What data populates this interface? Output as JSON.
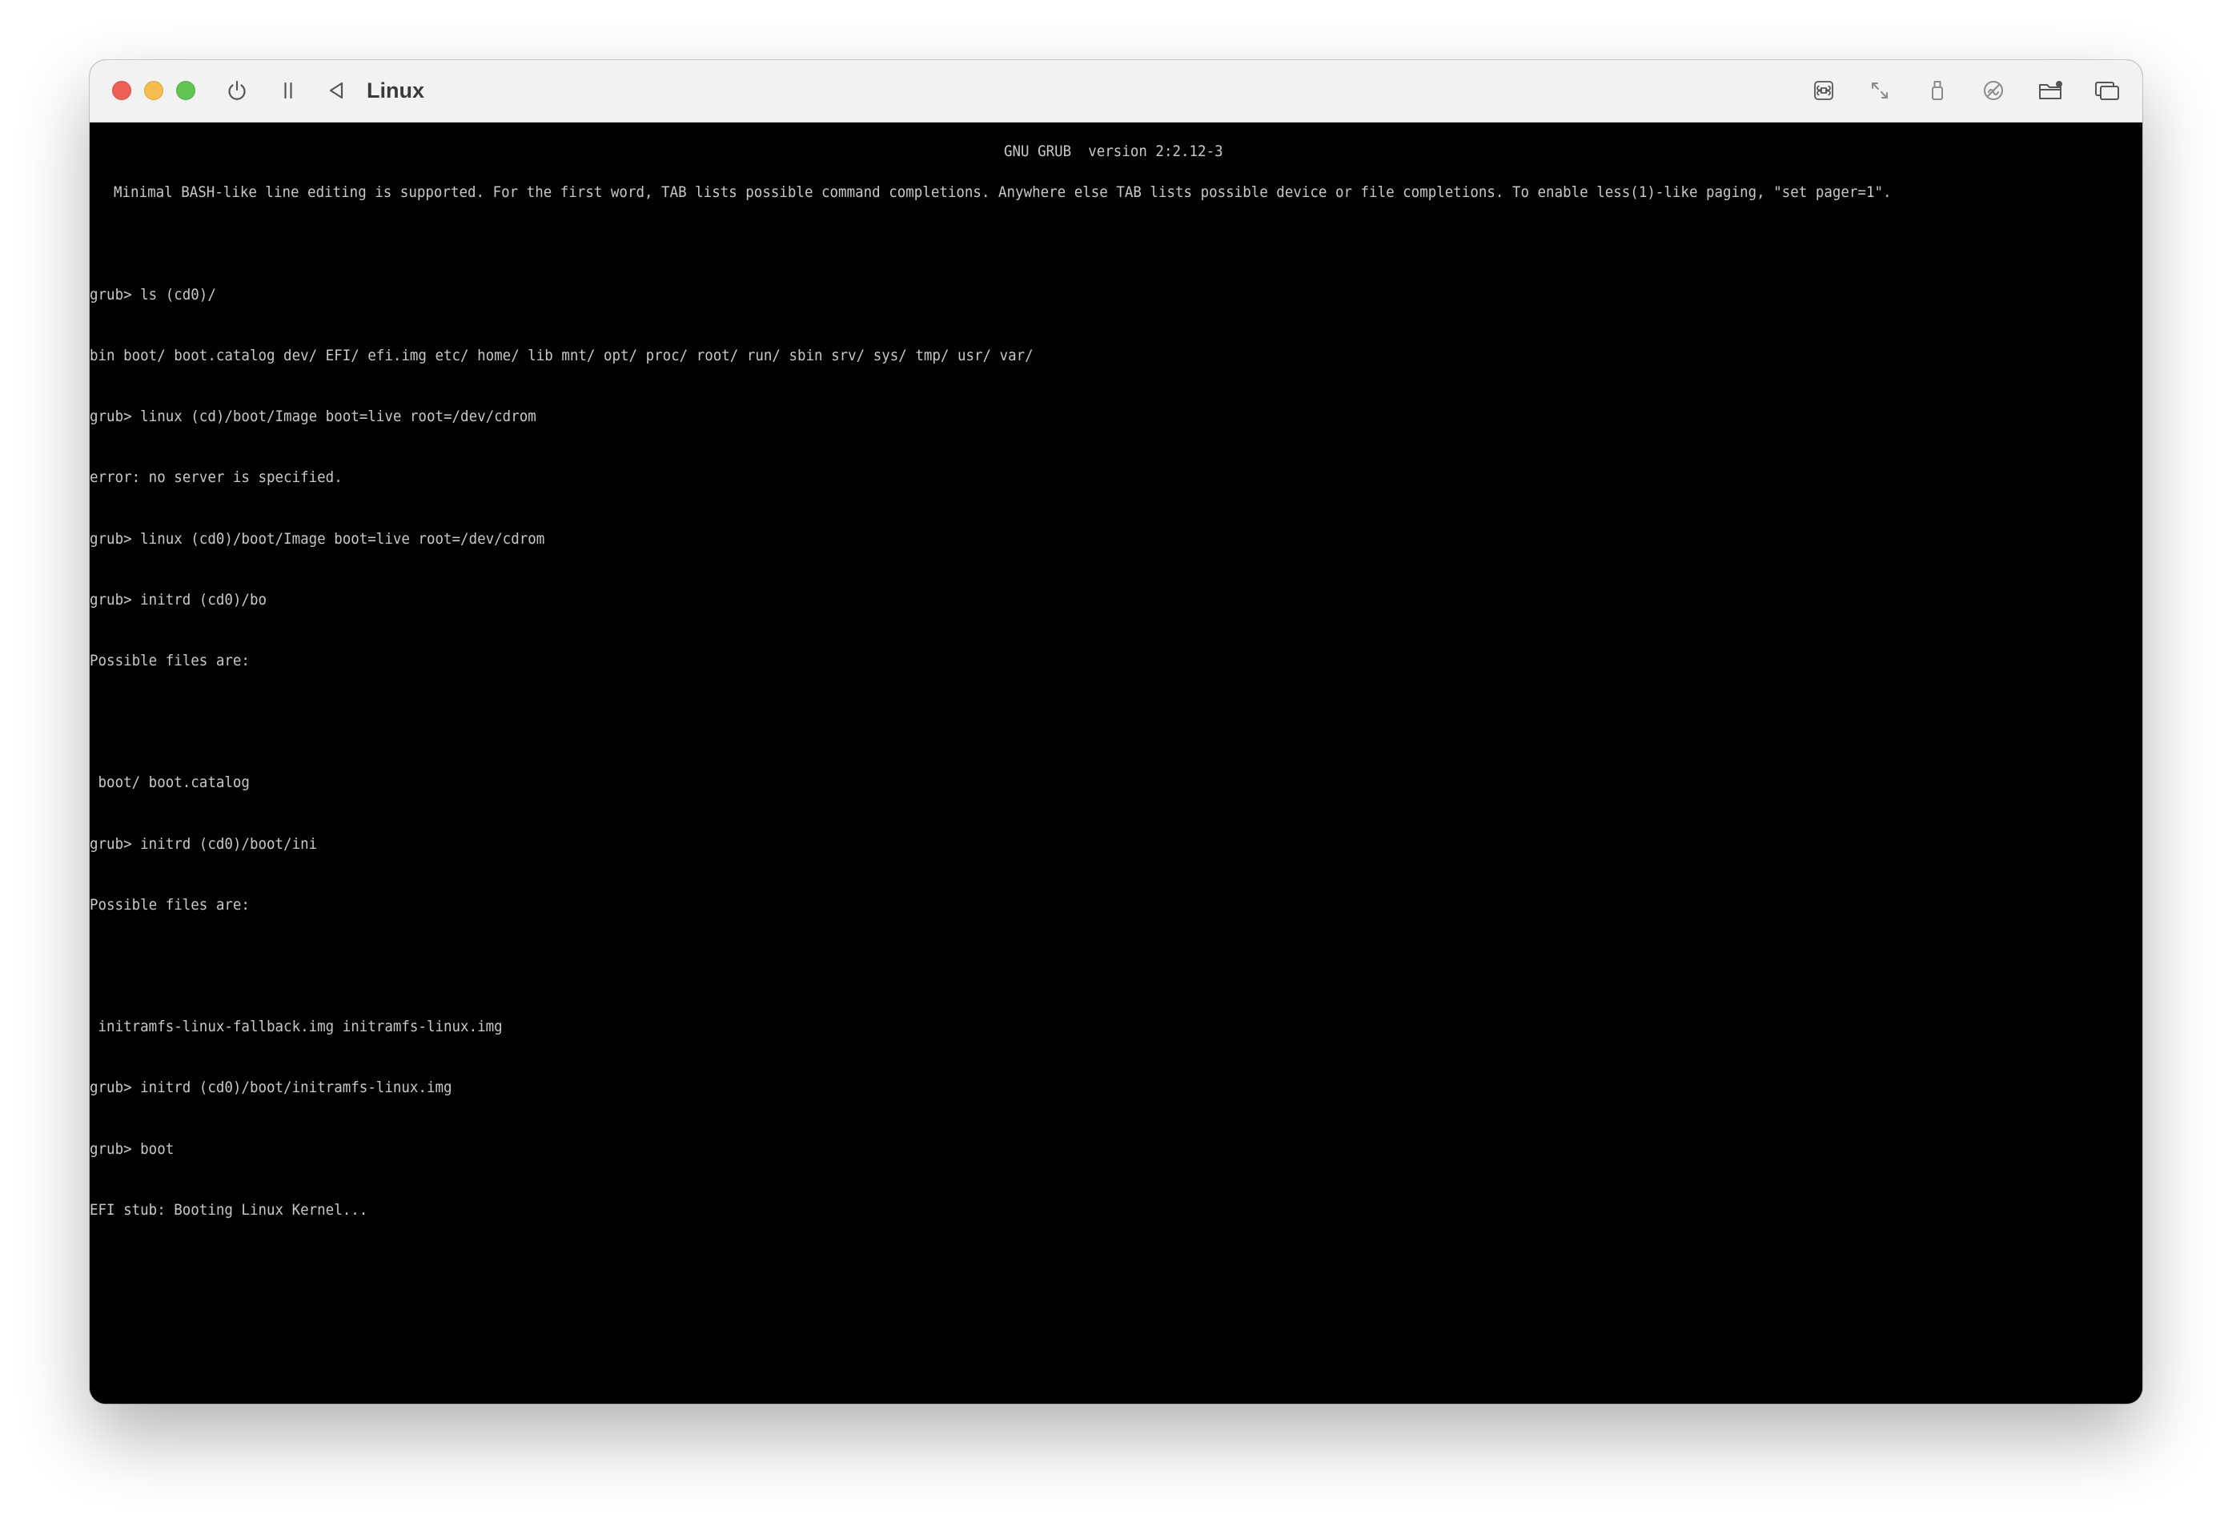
{
  "window": {
    "title": "Linux",
    "traffic_lights": {
      "close": "#ed5f57",
      "minimize": "#f5bd4f",
      "zoom": "#61c454"
    },
    "toolbar_left": [
      "power-icon",
      "pause-icon",
      "back-icon"
    ],
    "toolbar_right": [
      "command-key-icon",
      "resize-arrows-icon",
      "usb-icon",
      "audio-icon",
      "shared-folder-icon",
      "display-windows-icon"
    ]
  },
  "terminal": {
    "header": "GNU GRUB  version 2:2.12-3",
    "info": "Minimal BASH-like line editing is supported. For the first word, TAB lists possible command completions. Anywhere else TAB lists possible device or file completions. To enable less(1)-like paging, \"set pager=1\".",
    "lines": [
      "grub> ls (cd0)/",
      "bin boot/ boot.catalog dev/ EFI/ efi.img etc/ home/ lib mnt/ opt/ proc/ root/ run/ sbin srv/ sys/ tmp/ usr/ var/",
      "grub> linux (cd)/boot/Image boot=live root=/dev/cdrom",
      "error: no server is specified.",
      "grub> linux (cd0)/boot/Image boot=live root=/dev/cdrom",
      "grub> initrd (cd0)/bo",
      "Possible files are:",
      "",
      " boot/ boot.catalog",
      "grub> initrd (cd0)/boot/ini",
      "Possible files are:",
      "",
      " initramfs-linux-fallback.img initramfs-linux.img",
      "grub> initrd (cd0)/boot/initramfs-linux.img",
      "grub> boot",
      "EFI stub: Booting Linux Kernel..."
    ]
  }
}
